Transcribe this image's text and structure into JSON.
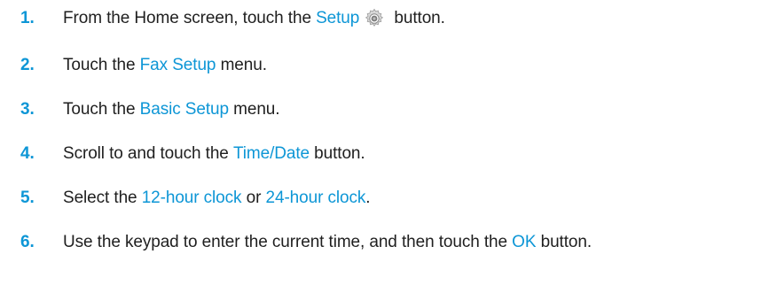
{
  "steps": [
    {
      "number": "1.",
      "before": "From the Home screen, touch the ",
      "highlight": "Setup",
      "icon": "gear-icon",
      "after": " button."
    },
    {
      "number": "2.",
      "before": "Touch the ",
      "highlight": "Fax Setup",
      "after": " menu."
    },
    {
      "number": "3.",
      "before": "Touch the ",
      "highlight": "Basic Setup",
      "after": " menu."
    },
    {
      "number": "4.",
      "before": "Scroll to and touch the ",
      "highlight": "Time/Date",
      "after": " button."
    },
    {
      "number": "5.",
      "before": "Select the ",
      "highlight": "12-hour clock",
      "middle": " or ",
      "highlight2": "24-hour clock",
      "after": "."
    },
    {
      "number": "6.",
      "before": "Use the keypad to enter the current time, and then touch the ",
      "highlight": "OK",
      "after": " button."
    }
  ],
  "colors": {
    "accent": "#0d96d6",
    "text": "#1f1f1f",
    "background": "#ffffff"
  }
}
